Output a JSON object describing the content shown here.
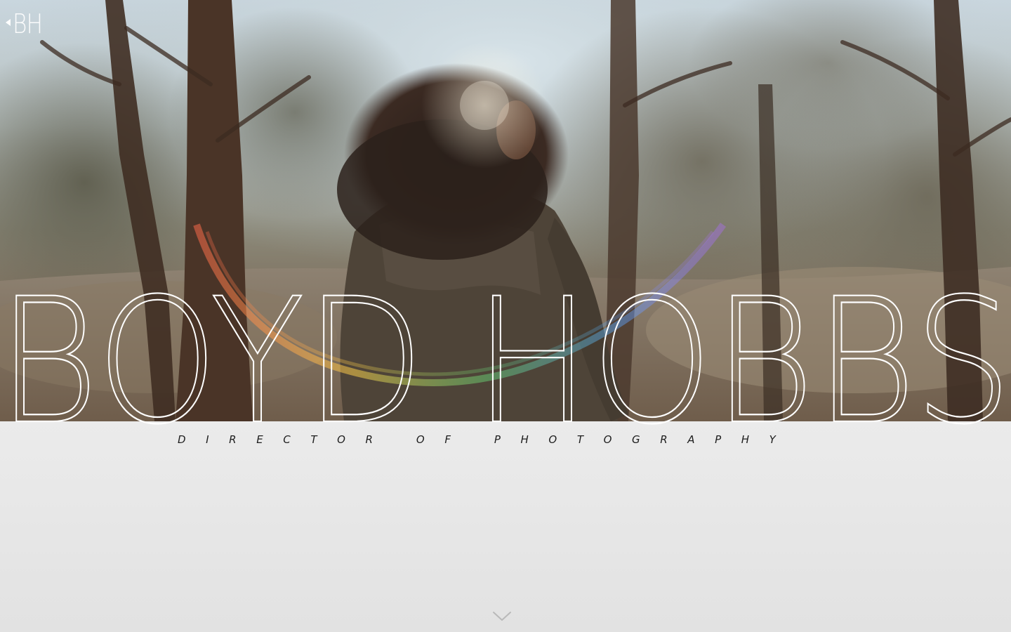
{
  "logo": {
    "text": "BH",
    "icon": "back-arrow-icon"
  },
  "hero": {
    "name": "BOYD HOBBS",
    "subtitle": "DIRECTOR OF PHOTOGRAPHY"
  },
  "scroll": {
    "icon": "chevron-down-icon"
  },
  "colors": {
    "name_text": "#ffffff",
    "subtitle_text": "#1d1d1d",
    "lower_bg": "#e6e6e6"
  }
}
